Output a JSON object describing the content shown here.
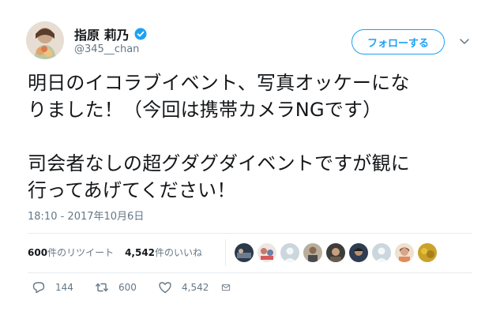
{
  "user": {
    "display_name": "指原 莉乃",
    "handle": "@345__chan",
    "verified_icon": "verified-badge-icon"
  },
  "follow_button": {
    "label": "フォローする"
  },
  "tweet": {
    "text": "明日のイコラブイベント、写真オッケーにな\nりました！（今回は携帯カメラNGです）\n\n司会者なしの超グダグダイベントですが観に\n行ってあげてください！",
    "timestamp": "18:10 - 2017年10月6日"
  },
  "stats": {
    "retweets_num": "600",
    "retweets_label": "件のリツイート",
    "likes_num": "4,542",
    "likes_label": "件のいいね"
  },
  "likers": [
    "avatar-1",
    "avatar-2",
    "avatar-3",
    "avatar-4",
    "avatar-5",
    "avatar-6",
    "avatar-7",
    "avatar-8",
    "avatar-9"
  ],
  "actions": {
    "reply_count": "144",
    "retweet_count": "600",
    "like_count": "4,542"
  },
  "colors": {
    "accent": "#1da1f2",
    "secondary_text": "#657786",
    "divider": "#e6ecf0"
  }
}
